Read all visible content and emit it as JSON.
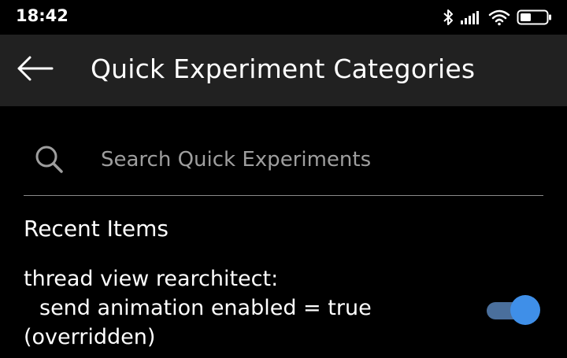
{
  "status_bar": {
    "time": "18:42",
    "icons": [
      "bluetooth-icon",
      "signal-icon",
      "wifi-icon",
      "battery-icon"
    ]
  },
  "app_bar": {
    "back_icon": "arrow-left-icon",
    "title": "Quick Experiment Categories"
  },
  "search": {
    "icon": "search-icon",
    "placeholder": "Search Quick Experiments",
    "value": ""
  },
  "recent": {
    "header": "Recent Items",
    "items": [
      {
        "line1": "thread view rearchitect:",
        "line2": "send animation enabled = true",
        "line3": "(overridden)",
        "toggle_on": true
      }
    ]
  },
  "colors": {
    "background": "#000000",
    "app_bar": "#212121",
    "accent": "#3f8fe8",
    "toggle_track": "#4a6f9c",
    "divider": "#8a8a8a",
    "placeholder": "#9e9e9e"
  }
}
